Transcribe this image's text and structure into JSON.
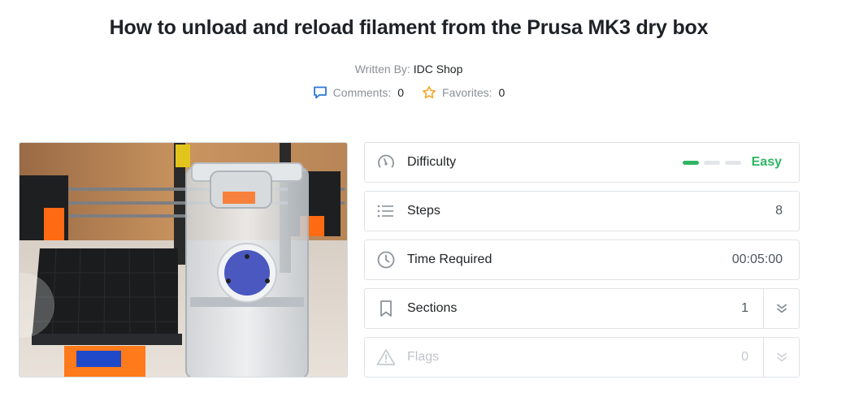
{
  "guide": {
    "title": "How to unload and reload filament from the Prusa MK3 dry box",
    "written_by_label": "Written By:",
    "author": "IDC Shop",
    "comments_label": "Comments:",
    "comments_count": "0",
    "favorites_label": "Favorites:",
    "favorites_count": "0"
  },
  "details": {
    "difficulty": {
      "label": "Difficulty",
      "value": "Easy",
      "level": 1,
      "level_max": 3
    },
    "steps": {
      "label": "Steps",
      "value": "8"
    },
    "time": {
      "label": "Time Required",
      "value": "00:05:00"
    },
    "sections": {
      "label": "Sections",
      "value": "1"
    },
    "flags": {
      "label": "Flags",
      "value": "0"
    }
  },
  "colors": {
    "accent_blue": "#2a78d8",
    "star_orange": "#f5a623",
    "easy_green": "#2fb563"
  }
}
